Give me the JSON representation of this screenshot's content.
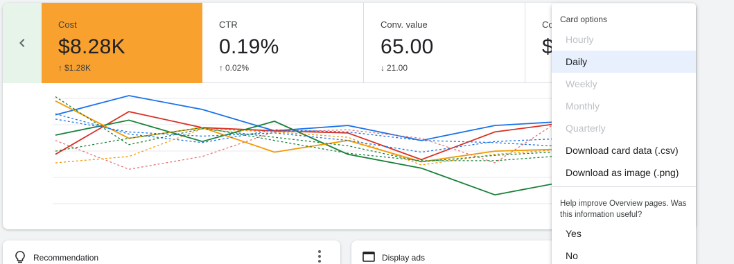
{
  "metrics": [
    {
      "label": "Cost",
      "value": "$8.28K",
      "change": "$1.28K",
      "direction": "up",
      "highlighted": true
    },
    {
      "label": "CTR",
      "value": "0.19%",
      "change": "0.02%",
      "direction": "up"
    },
    {
      "label": "Conv. value",
      "value": "65.00",
      "change": "21.00",
      "direction": "down"
    },
    {
      "label": "Co",
      "value": "$"
    }
  ],
  "icons": {
    "back": "chevron-left-icon",
    "recommendation": "lightbulb-icon",
    "display": "display-ads-icon",
    "more": "more-vert-icon"
  },
  "colors": {
    "cost_highlight": "#f9a12e",
    "back_tile": "#e6f4ea",
    "selected_item": "#e8f0fe",
    "series_blue": "#1a73e8",
    "series_red": "#d93025",
    "series_green": "#188038",
    "series_orange": "#f29900",
    "series_pink": "#e57373"
  },
  "chart_data": {
    "type": "line",
    "grid": true,
    "series": [
      {
        "color": "#1a73e8",
        "style": "solid",
        "values": [
          82,
          100,
          87,
          67,
          72,
          58,
          72,
          76
        ]
      },
      {
        "color": "#d93025",
        "style": "solid",
        "values": [
          45,
          85,
          70,
          67,
          65,
          40,
          66,
          75
        ]
      },
      {
        "color": "#188038",
        "style": "solid",
        "values": [
          63,
          77,
          57,
          76,
          45,
          32,
          7,
          20
        ]
      },
      {
        "color": "#f29900",
        "style": "solid",
        "values": [
          95,
          60,
          70,
          47,
          58,
          38,
          48,
          50
        ]
      },
      {
        "color": "#1a73e8",
        "style": "dashed",
        "values": [
          83,
          64,
          56,
          68,
          66,
          58,
          56,
          52
        ]
      },
      {
        "color": "#188038",
        "style": "dashed",
        "values": [
          48,
          60,
          70,
          58,
          46,
          39,
          39,
          44
        ]
      },
      {
        "color": "#e57373",
        "style": "dashed",
        "values": [
          58,
          31,
          43,
          66,
          68,
          60,
          37,
          82
        ]
      },
      {
        "color": "#f29900",
        "style": "dashed",
        "values": [
          37,
          43,
          69,
          66,
          61,
          35,
          45,
          50
        ]
      },
      {
        "color": "#188038",
        "style": "dashed",
        "values": [
          99,
          54,
          69,
          61,
          53,
          38,
          44,
          48
        ]
      },
      {
        "color": "#1a73e8",
        "style": "dashed",
        "values": [
          78,
          66,
          62,
          65,
          58,
          47,
          57,
          60
        ]
      }
    ]
  },
  "cards": {
    "recommendation": "Recommendation",
    "display": "Display ads"
  },
  "menu": {
    "title": "Card options",
    "items": [
      {
        "label": "Hourly",
        "disabled": true
      },
      {
        "label": "Daily",
        "selected": true
      },
      {
        "label": "Weekly",
        "disabled": true
      },
      {
        "label": "Monthly",
        "disabled": true
      },
      {
        "label": "Quarterly",
        "disabled": true
      },
      {
        "label": "Download card data (.csv)"
      },
      {
        "label": "Download as image (.png)"
      }
    ],
    "help_text": "Help improve Overview pages. Was this information useful?",
    "feedback": [
      {
        "label": "Yes"
      },
      {
        "label": "No"
      }
    ]
  }
}
